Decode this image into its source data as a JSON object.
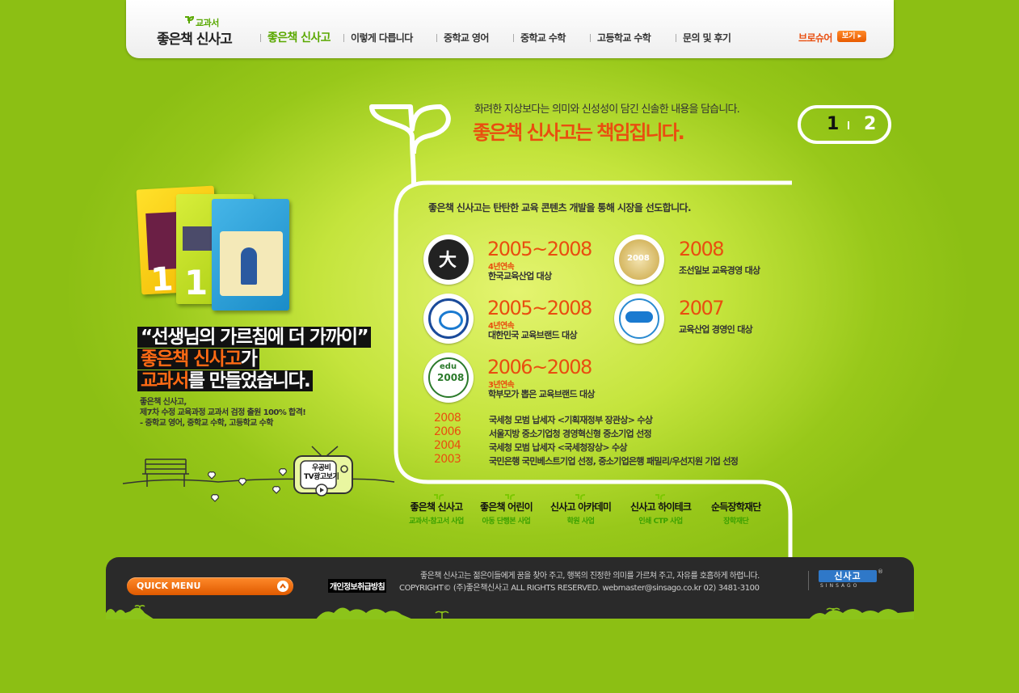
{
  "brand": {
    "logo_small": "교과서",
    "logo_big": "좋은책 신사고"
  },
  "nav": {
    "items": [
      {
        "label": "좋은책 신사고",
        "active": true
      },
      {
        "label": "이렇게 다릅니다"
      },
      {
        "label": "중학교 영어"
      },
      {
        "label": "중학교 수학"
      },
      {
        "label": "고등학교 수학"
      },
      {
        "label": "문의 및 후기"
      }
    ],
    "brochure_label": "브로슈어",
    "brochure_button": "보기"
  },
  "hero": {
    "subtitle": "화려한 지상보다는 의미와 신성성이 담긴 신솔한 내용을 담습니다.",
    "title": "좋은책 신사고는 책임집니다.",
    "pager": [
      "1",
      "2"
    ]
  },
  "left": {
    "quote_line1": "“선생님의 가르침에 더 가까이”",
    "quote_line2_brand": "좋은책 신사고",
    "quote_line2_rest": "가",
    "quote_line3_brand": "교과서",
    "quote_line3_rest": "를 만들었습니다.",
    "desc_line1": "좋은책 신사고,",
    "desc_line2": "제7차 수정 교육과정 교과서 검정 출원 100% 합격!",
    "desc_line3": "- 중학교 영어, 중학교 수학, 고등학교 수학",
    "tv_label_1": "우공비",
    "tv_label_2": "TV광고보기"
  },
  "awards": {
    "heading": "좋은책 신사고는 탄탄한 교육 콘텐츠 개발을 통해 시장을 선도합니다.",
    "items": [
      {
        "years": "2005~2008",
        "streak": "4년연속",
        "name": "한국교육산업 대상",
        "icon": "daesang-badge-icon"
      },
      {
        "years": "2008",
        "streak": "",
        "name": "조선일보 교육경영 대상",
        "icon": "chosun-award-badge-icon"
      },
      {
        "years": "2005~2008",
        "streak": "4년연속",
        "name": "대한민국 교육브랜드 대상",
        "icon": "korea-brand-badge-icon"
      },
      {
        "years": "2007",
        "streak": "",
        "name": "교육산업 경영인 대상",
        "icon": "education-ceo-badge-icon"
      },
      {
        "years": "2006~2008",
        "streak": "3년연속",
        "name": "학부모가 뽑은 교육브랜드 대상",
        "icon": "edu-parents-badge-icon"
      }
    ],
    "history": [
      {
        "year": "2008",
        "text": "국세청 모범 납세자 <기획재정부 장관상> 수상"
      },
      {
        "year": "2006",
        "text": "서울지방 중소기업청 경영혁신형 중소기업 선정"
      },
      {
        "year": "2004",
        "text": "국세청 모범 납세자 <국세청장상> 수상"
      },
      {
        "year": "2003",
        "text": "국민은행 국민베스트기업 선정, 중소기업은행 패밀리/우선지원 기업 선정"
      }
    ]
  },
  "companies": [
    {
      "name": "좋은책 신사고",
      "desc": "교과서·참고서 사업"
    },
    {
      "name": "좋은책 어린이",
      "desc": "아동 단행본 사업"
    },
    {
      "name": "신사고 아카데미",
      "desc": "학원 사업"
    },
    {
      "name": "신사고 하이테크",
      "desc": "인쇄 CTP 사업"
    },
    {
      "name": "순득장학재단",
      "desc": "장학재단"
    }
  ],
  "footer": {
    "quick_menu": "QUICK MENU",
    "privacy": "개인정보취급방침",
    "message": "좋은책 신사고는 젊은이들에게 꿈을 찾아 주고, 행복의 진정한 의미를 가르쳐 주고, 자유를 호흡하게 하렵니다.",
    "copyright": "COPYRIGHT© (주)좋은책신사고 ALL RIGHTS RESERVED. webmaster@sinsago.co.kr  02) 3481-3100",
    "logo": "신사고",
    "logo_sub": "SINSAGO",
    "reg": "®"
  },
  "colors": {
    "accent_orange": "#e94e0f",
    "brand_green": "#5aa800",
    "background_green": "#b4dc2c"
  }
}
